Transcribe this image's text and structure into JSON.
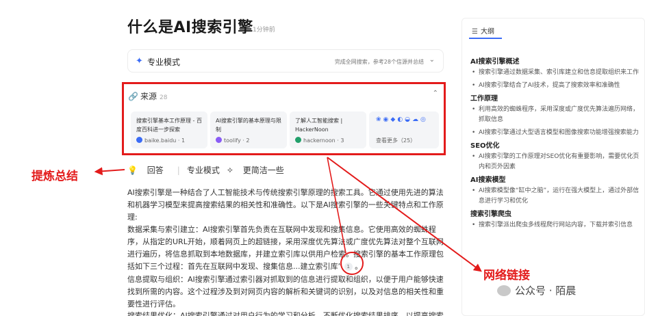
{
  "header": {
    "title": "什么是AI搜索引擎",
    "time": "1分钟前"
  },
  "mode": {
    "label": "专业模式",
    "status": "完成全网搜索，参考28个信源并总结"
  },
  "sources": {
    "label": "来源",
    "count": "28",
    "cards": [
      {
        "title": "搜索引擎基本工作原理 - 百度百科进一步探索",
        "site": "baike.baidu · 1",
        "color": "#3b6cf6"
      },
      {
        "title": "AI搜索引擎的基本原理与限制",
        "site": "toolify · 2",
        "color": "#8a5cf6"
      },
      {
        "title": "了解人工智能搜索 | HackerNoon",
        "site": "hackernoon · 3",
        "color": "#22a06b"
      }
    ],
    "more_icons": "❀◉◆◐◒☁◎",
    "see_more": "查看更多（25）"
  },
  "tabs": {
    "answer": "回答",
    "pro": "专业模式",
    "simpler": "更简洁一些"
  },
  "annotations": {
    "left": "提炼总结",
    "right": "网络链接"
  },
  "content": {
    "p1": "AI搜索引擎是一种结合了人工智能技术与传统搜索引擎原理的搜索工具。它通过使用先进的算法和机器学习模型来提高搜索结果的相关性和准确性。以下是AI搜索引擎的一些关键特点和工作原理:",
    "p2": "数据采集与索引建立：AI搜索引擎首先负责在互联网中发现和搜集信息。它使用高效的蜘蛛程序，从指定的URL开始，顺着网页上的超链接，采用深度优先算法或广度优先算法对整个互联网进行遍历，将信息抓取到本地数据库，并建立索引库以供用户检索。搜索引擎的基本工作原理包括如下三个过程：首先在互联网中发现、搜集信息...建立索引库”",
    "p2_cite": "1",
    "p3": "信息提取与组织：AI搜索引擎通过索引器对抓取到的信息进行提取和组织，以便于用户能够快速找到所需的内容。这个过程涉及到对网页内容的解析和关键词的识别，以及对信息的相关性和重要性进行评估。",
    "p4": "搜索结果优化：AI搜索引擎通过对用户行为的学习和分析，不断优化搜索结果排序，以提高搜索体验。"
  },
  "outline": {
    "tab_label": "大纲",
    "sections": [
      {
        "title": "AI搜索引擎概述",
        "items": [
          "搜索引擎通过数据采集、索引库建立和信息提取组织来工作",
          "AI搜索引擎结合了AI技术，提高了搜索效率和准确性"
        ]
      },
      {
        "title": "工作原理",
        "items": [
          "利用高效的蜘蛛程序，采用深度或广度优先算法遍历网络，抓取信息",
          "AI搜索引擎通过大型语言模型和图像搜索功能增强搜索能力"
        ]
      },
      {
        "title": "SEO优化",
        "items": [
          "AI搜索引擎的工作原理对SEO优化有重要影响，需要优化页内和页外因素"
        ]
      },
      {
        "title": "AI搜索模型",
        "items": [
          "AI搜索模型像“缸中之脑”，运行在强大模型上，通过外部信息进行学习和优化"
        ]
      },
      {
        "title": "搜索引擎爬虫",
        "items": [
          "搜索引擎派出爬虫多线程爬行网站内容，下载并索引信息"
        ]
      }
    ]
  },
  "watermark": {
    "text": "公众号 · 陌晨"
  }
}
